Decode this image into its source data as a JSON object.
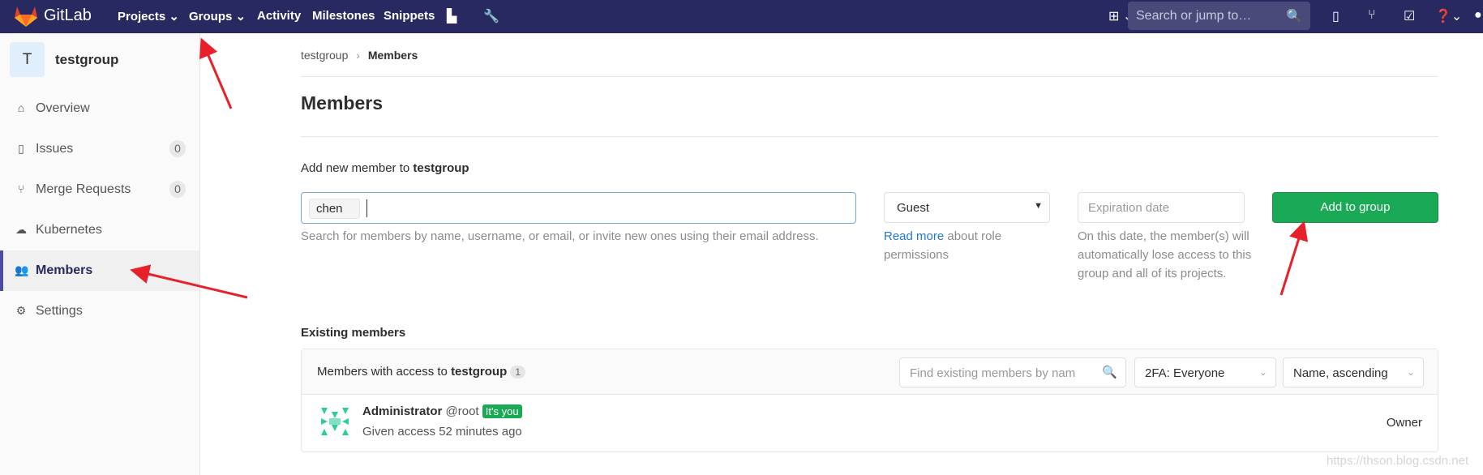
{
  "header": {
    "brand": "GitLab",
    "nav": [
      "Projects",
      "Groups",
      "Activity",
      "Milestones",
      "Snippets"
    ],
    "search_placeholder": "Search or jump to…"
  },
  "sidebar": {
    "avatar_letter": "T",
    "group": "testgroup",
    "items": [
      {
        "label": "Overview",
        "icon": "home-icon"
      },
      {
        "label": "Issues",
        "icon": "issues-icon",
        "badge": "0"
      },
      {
        "label": "Merge Requests",
        "icon": "merge-request-icon",
        "badge": "0"
      },
      {
        "label": "Kubernetes",
        "icon": "kubernetes-icon"
      },
      {
        "label": "Members",
        "icon": "users-icon",
        "active": true
      },
      {
        "label": "Settings",
        "icon": "gear-icon"
      }
    ]
  },
  "breadcrumb": {
    "parent": "testgroup",
    "current": "Members"
  },
  "title": "Members",
  "add": {
    "label": "Add new member to ",
    "group": "testgroup",
    "token": "chen",
    "help": "Search for members by name, username, or email, or invite new ones using their email address.",
    "role": "Guest",
    "read_more": "Read more",
    "role_help": " about role permissions",
    "date_placeholder": "Expiration date",
    "date_help": "On this date, the member(s) will automatically lose access to this group and all of its projects.",
    "button": "Add to group",
    "button_color": "#1aaa55"
  },
  "existing": {
    "heading": "Existing members",
    "panel_label": "Members with access to ",
    "group": "testgroup",
    "count": "1",
    "search_placeholder": "Find existing members by nam",
    "filter_2fa": "2FA: Everyone",
    "sort": "Name, ascending",
    "members": [
      {
        "name": "Administrator",
        "username": "@root",
        "badge": "It's you",
        "access": "Given access 52 minutes ago",
        "role": "Owner"
      }
    ]
  },
  "watermark": "https://thson.blog.csdn.net"
}
